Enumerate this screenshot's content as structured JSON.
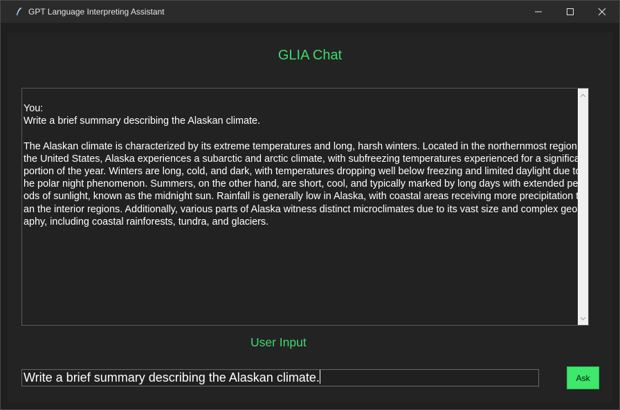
{
  "window": {
    "title": "GPT Language Interpreting Assistant",
    "icon": "feather-icon"
  },
  "main": {
    "heading": "GLIA Chat",
    "chat": {
      "speaker": "You:",
      "prompt": "Write a brief summary describing the Alaskan climate.",
      "response": "The Alaskan climate is characterized by its extreme temperatures and long, harsh winters. Located in the northernmost region of the United States, Alaska experiences a subarctic and arctic climate, with subfreezing temperatures experienced for a significant portion of the year. Winters are long, cold, and dark, with temperatures dropping well below freezing and limited daylight due to the polar night phenomenon. Summers, on the other hand, are short, cool, and typically marked by long days with extended periods of sunlight, known as the midnight sun. Rainfall is generally low in Alaska, with coastal areas receiving more precipitation than the interior regions. Additionally, various parts of Alaska witness distinct microclimates due to its vast size and complex geography, including coastal rainforests, tundra, and glaciers."
    },
    "user_input_label": "User Input",
    "input_value": "Write a brief summary describing the Alaskan climate.",
    "ask_label": "Ask"
  },
  "colors": {
    "accent": "#3fda6e",
    "background": "#232323",
    "button": "#3de86b"
  }
}
